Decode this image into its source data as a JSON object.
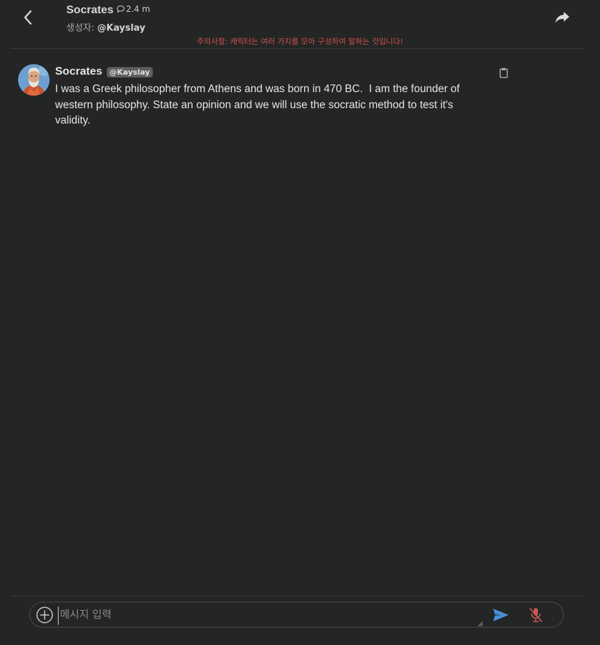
{
  "header": {
    "title": "Socrates",
    "chat_count": "2.4 m",
    "creator_prefix": "생성자:",
    "creator_handle": "@Kayslay",
    "notice": "주의사항: 캐릭터는 여러 가지를 모아 구성하여 말하는 것입니다!"
  },
  "message": {
    "name": "Socrates",
    "badge": "@Kayslay",
    "text": "I was a Greek philosopher from Athens and was born in 470 BC.  I am the founder of western philosophy. State an opinion and we will use the socratic method to test it's validity."
  },
  "composer": {
    "placeholder": "메시지 입력",
    "value": ""
  },
  "icons": {
    "back": "chevron-left-icon",
    "chat_count": "chat-bubble-icon",
    "share": "share-arrow-icon",
    "copy": "clipboard-icon",
    "add": "plus-circle-icon",
    "send": "send-icon",
    "mic": "mic-off-icon"
  },
  "colors": {
    "background": "#242525",
    "notice": "#d0524c",
    "send": "#4a90d9",
    "mic_off": "#c9575a",
    "badge_bg": "#5b5d5e"
  }
}
